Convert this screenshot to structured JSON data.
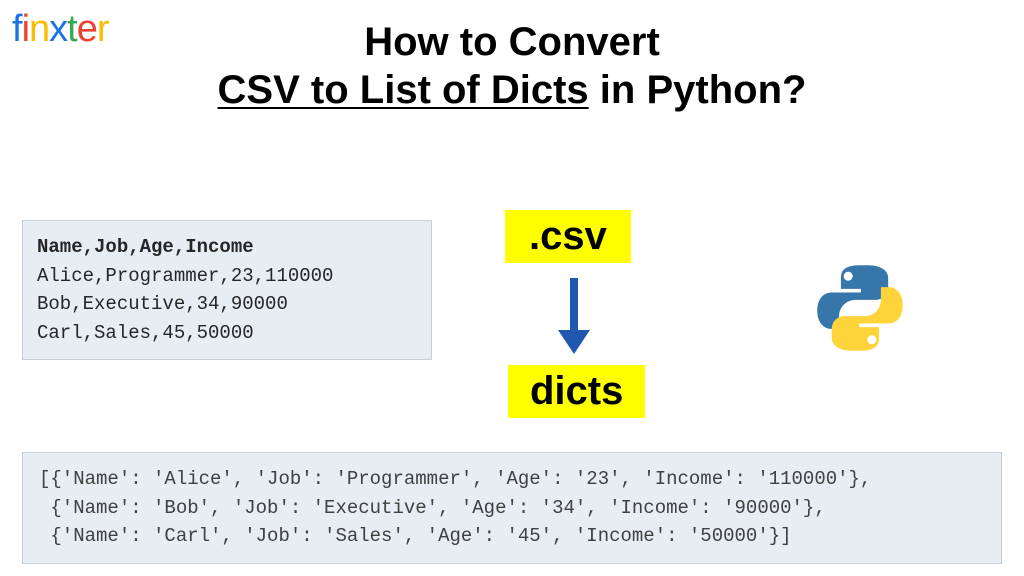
{
  "logo": {
    "c1": "f",
    "c2": "i",
    "c3": "n",
    "c4": "x",
    "c5": "t",
    "c6": "e",
    "c7": "r"
  },
  "title": {
    "line1": "How to Convert",
    "underlined": "CSV to List of Dicts",
    "line2_suffix": " in Python?"
  },
  "csv": {
    "header": "Name,Job,Age,Income",
    "row1": "Alice,Programmer,23,110000",
    "row2": "Bob,Executive,34,90000",
    "row3": "Carl,Sales,45,50000"
  },
  "badges": {
    "csv": ".csv",
    "dicts": "dicts"
  },
  "output": {
    "line1": "[{'Name': 'Alice', 'Job': 'Programmer', 'Age': '23', 'Income': '110000'},",
    "line2": " {'Name': 'Bob', 'Job': 'Executive', 'Age': '34', 'Income': '90000'},",
    "line3": " {'Name': 'Carl', 'Job': 'Sales', 'Age': '45', 'Income': '50000'}]"
  },
  "icons": {
    "arrow": "arrow-down-icon",
    "python": "python-logo-icon"
  }
}
